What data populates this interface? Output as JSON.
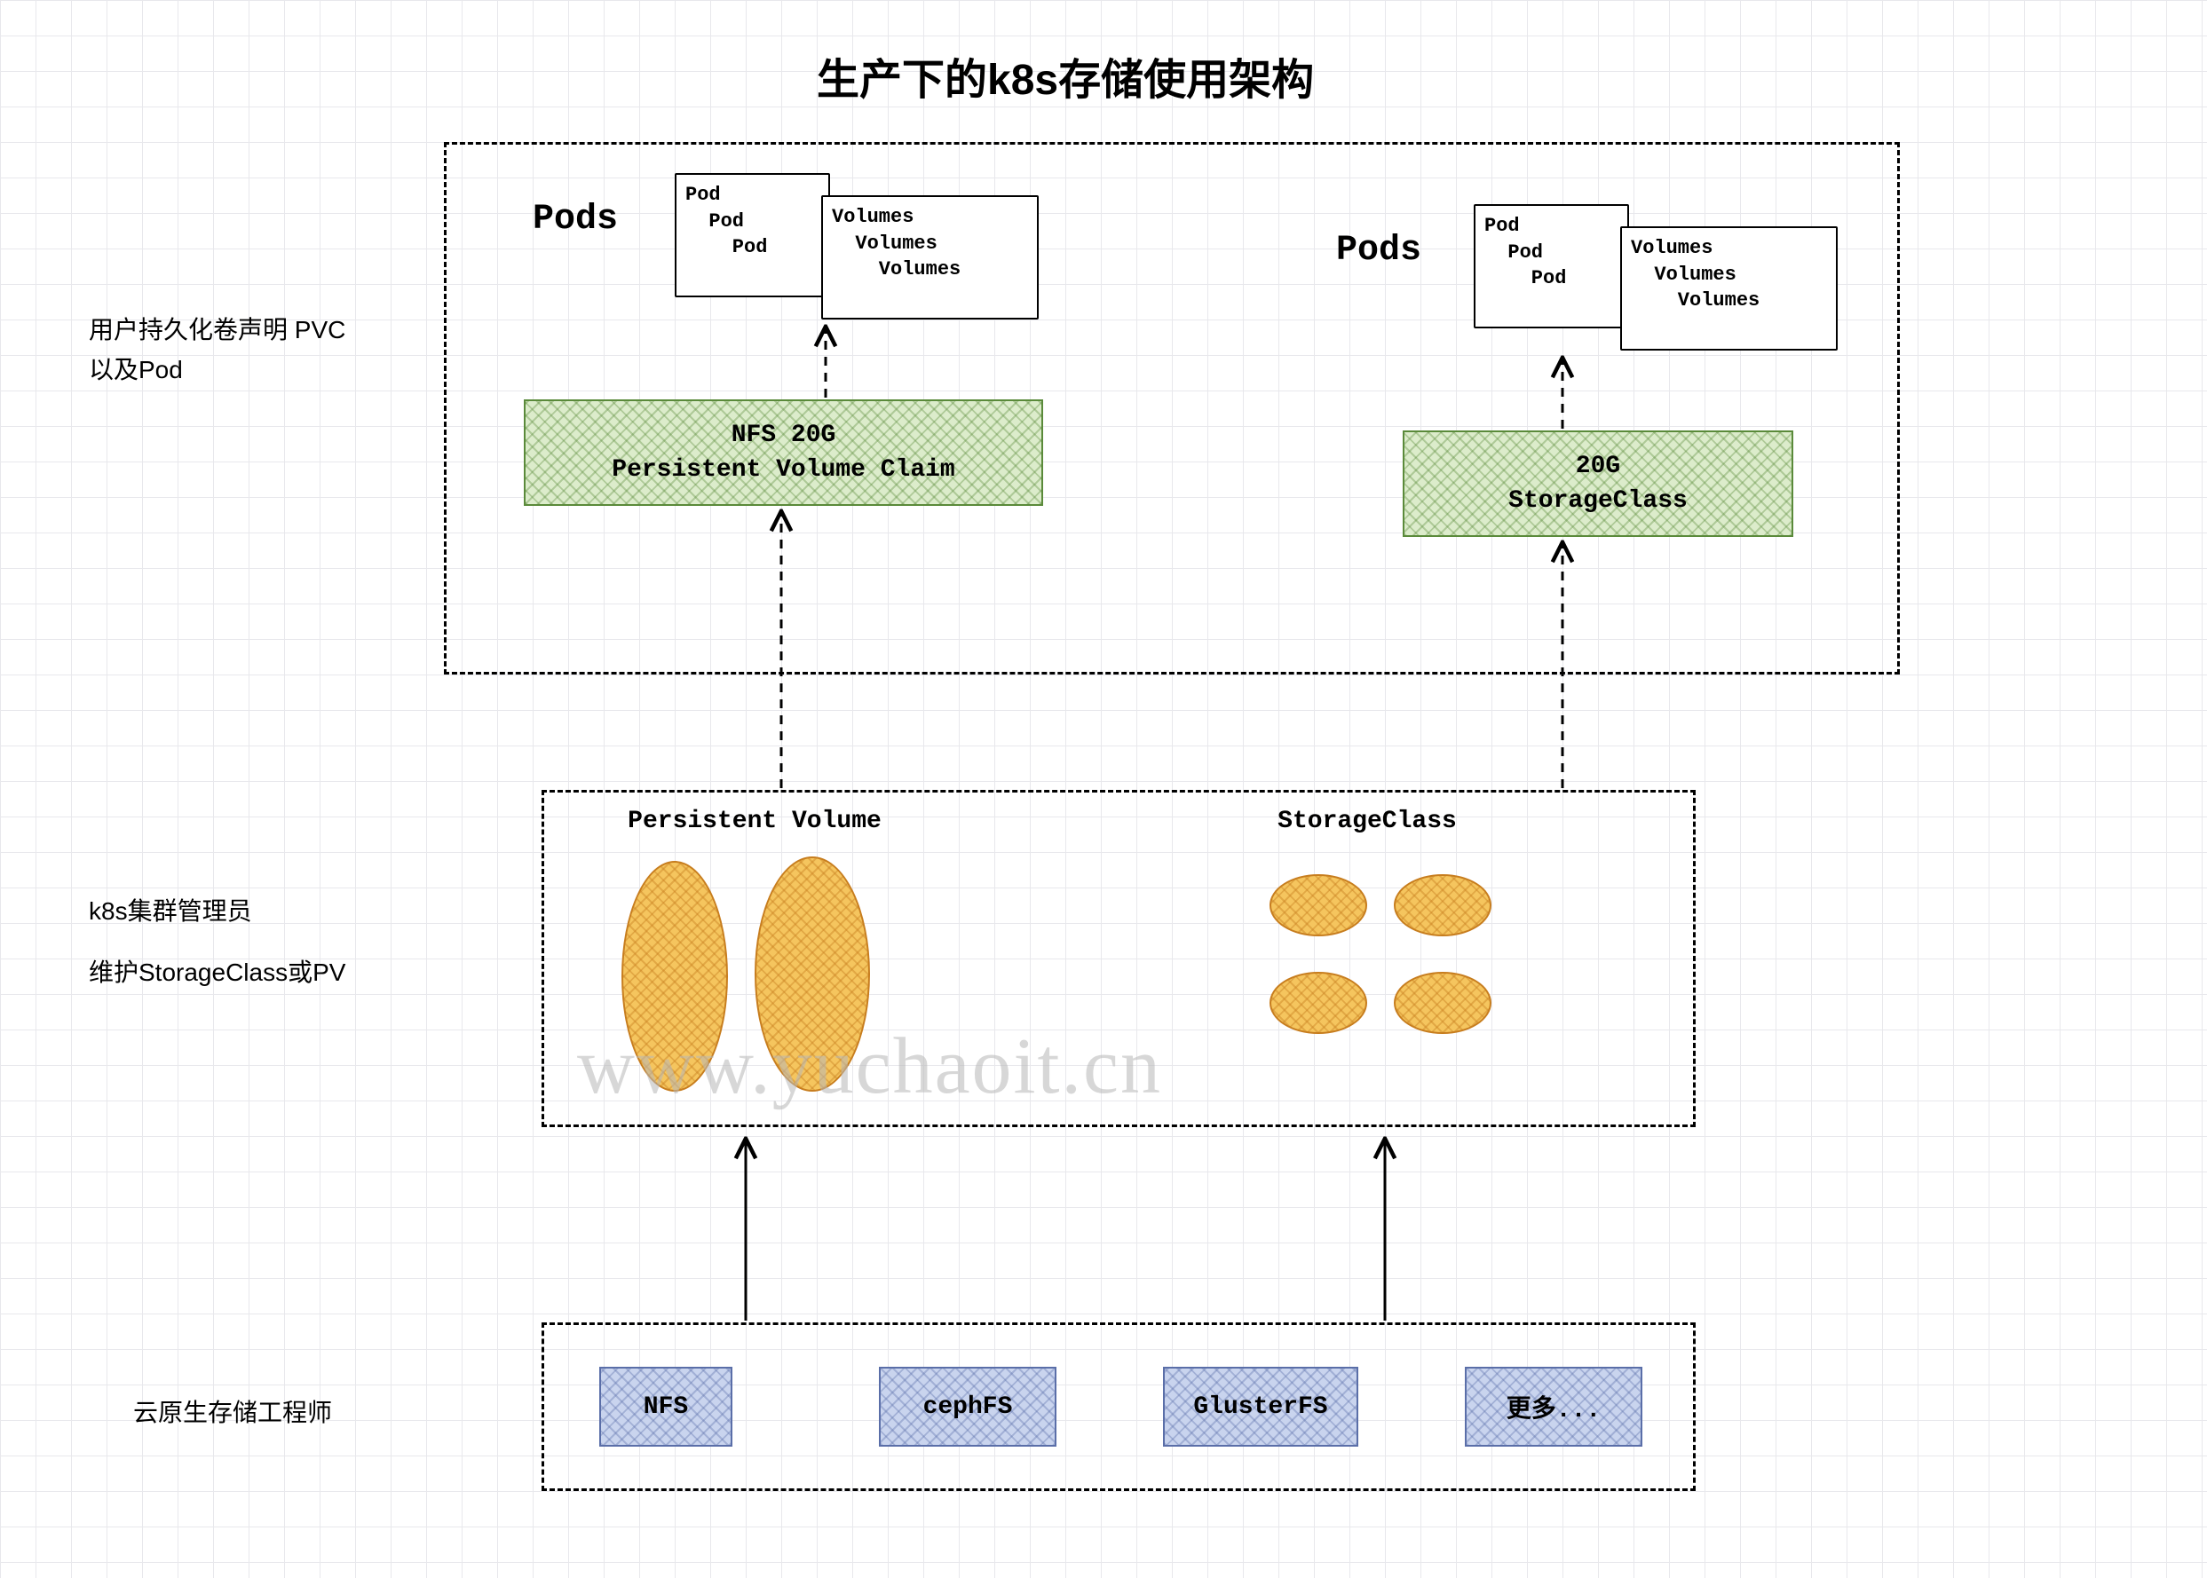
{
  "title": "生产下的k8s存储使用架构",
  "sideLabels": {
    "role1_line1": "用户持久化卷声明 PVC",
    "role1_line2": "以及Pod",
    "role2_line1": "k8s集群管理员",
    "role2_line2": "维护StorageClass或PV",
    "role3": "云原生存储工程师"
  },
  "pods": {
    "heading": "Pods",
    "podStack": "Pod\n  Pod\n    Pod",
    "volumesStack": "Volumes\n  Volumes\n    Volumes"
  },
  "pvc": {
    "line1": "NFS 20G",
    "line2": "Persistent Volume Claim"
  },
  "sc_claim": {
    "line1": "20G",
    "line2": "StorageClass"
  },
  "admin": {
    "pvLabel": "Persistent Volume",
    "scLabel": "StorageClass"
  },
  "storage": {
    "nfs": "NFS",
    "cephfs": "cephFS",
    "glusterfs": "GlusterFS",
    "more": "更多..."
  },
  "watermark": "www.yuchaoit.cn"
}
